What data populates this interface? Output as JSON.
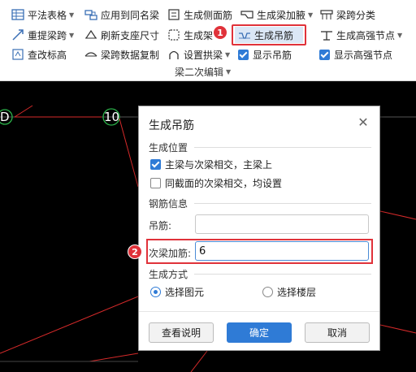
{
  "ribbon": {
    "row1": {
      "flat_table": "平法表格",
      "apply_same_beam": "应用到同名梁",
      "gen_side_rebar": "生成侧面筋",
      "gen_beam_haunch": "生成梁加腋",
      "span_classify": "梁跨分类"
    },
    "row2": {
      "relift_span": "重提梁跨",
      "refresh_support": "刷新支座尺寸",
      "gen_beam_stirrup": "生成架",
      "gen_hanger": "生成吊筋",
      "gen_high_node": "生成高强节点"
    },
    "row3": {
      "check_elevation": "查改标高",
      "copy_span_data": "梁跨数据复制",
      "set_arch_beam": "设置拱梁",
      "show_hanger": "显示吊筋",
      "show_high_node": "显示高强节点"
    },
    "group_label": "梁二次编辑",
    "callout1": "1"
  },
  "cad": {
    "axis_d": "D",
    "axis_10": "10"
  },
  "dialog": {
    "title": "生成吊筋",
    "sec_position": "生成位置",
    "opt_main_secondary": "主梁与次梁相交，主梁上",
    "opt_same_section": "同截面的次梁相交，均设置",
    "sec_rebar": "钢筋信息",
    "hanger_label": "吊筋:",
    "hanger_value": "",
    "secondary_label": "次梁加筋:",
    "secondary_value": "6",
    "sec_method": "生成方式",
    "radio_select_element": "选择图元",
    "radio_select_floor": "选择楼层",
    "btn_help": "查看说明",
    "btn_ok": "确定",
    "btn_cancel": "取消",
    "callout2": "2"
  }
}
